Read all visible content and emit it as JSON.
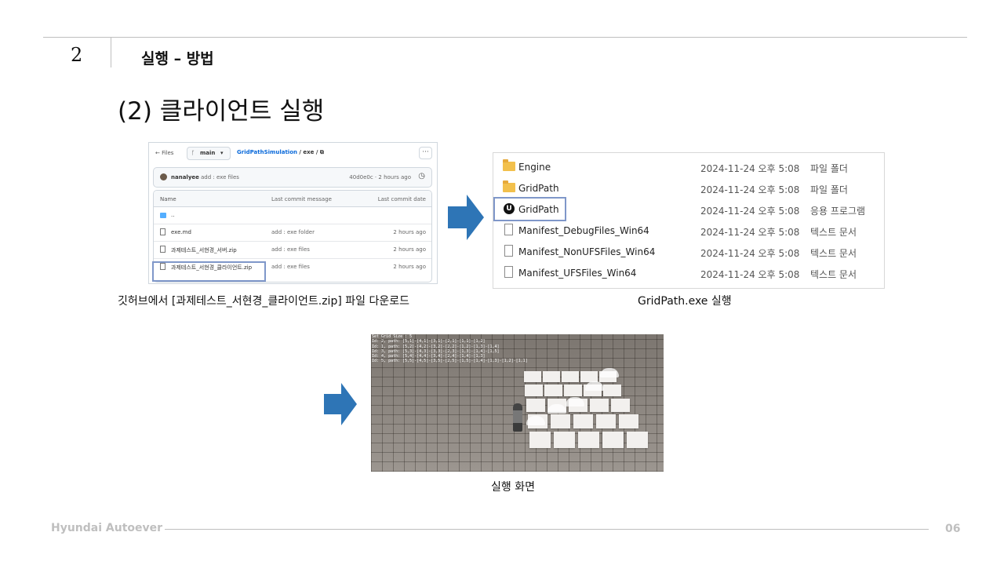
{
  "header": {
    "section_number": "2",
    "section_title": "실행 – 방법"
  },
  "subtitle": "(2) 클라이언트 실행",
  "github": {
    "files_label": "← Files",
    "branch": "main",
    "repo": "GridPathSimulation",
    "path": " / exe / ",
    "more": "···",
    "commit": {
      "user": "nanalyee",
      "message": "add : exe files",
      "hash_time": "40d0e0c · 2 hours ago"
    },
    "columns": [
      "Name",
      "Last commit message",
      "Last commit date"
    ],
    "rows": [
      {
        "name": "..",
        "message": "",
        "date": ""
      },
      {
        "name": "exe.md",
        "message": "add : exe folder",
        "date": "2 hours ago"
      },
      {
        "name": "과제테스트_서현경_서버.zip",
        "message": "add : exe files",
        "date": "2 hours ago"
      },
      {
        "name": "과제테스트_서현경_클라이언트.zip",
        "message": "add : exe files",
        "date": "2 hours ago"
      }
    ],
    "caption": "깃허브에서 [과제테스트_서현경_클라이언트.zip] 파일 다운로드"
  },
  "explorer": {
    "rows": [
      {
        "icon": "folder-icon",
        "name": "Engine",
        "date": "2024-11-24 오후 5:08",
        "type": "파일 폴더"
      },
      {
        "icon": "folder-icon",
        "name": "GridPath",
        "date": "2024-11-24 오후 5:08",
        "type": "파일 폴더"
      },
      {
        "icon": "unreal-icon",
        "name": "GridPath",
        "date": "2024-11-24 오후 5:08",
        "type": "응용 프로그램"
      },
      {
        "icon": "document-icon",
        "name": "Manifest_DebugFiles_Win64",
        "date": "2024-11-24 오후 5:08",
        "type": "텍스트 문서"
      },
      {
        "icon": "document-icon",
        "name": "Manifest_NonUFSFiles_Win64",
        "date": "2024-11-24 오후 5:08",
        "type": "텍스트 문서"
      },
      {
        "icon": "document-icon",
        "name": "Manifest_UFSFiles_Win64",
        "date": "2024-11-24 오후 5:08",
        "type": "텍스트 문서"
      }
    ],
    "caption": "GridPath.exe 실행"
  },
  "game": {
    "log": [
      "Set Grid Size : 5",
      "Id: 2, path: [5,1]-[4,1]-[3,1]-[2,1]-[1,1]-[1,2]",
      "Id: 1, path: [5,2]-[4,2]-[3,2]-[2,2]-[1,2]-[1,3]-[1,4]",
      "Id: 3, path: [5,3]-[4,3]-[3,3]-[2,3]-[1,3]-[1,4]-[1,5]",
      "Id: 4, path: [5,4]-[4,4]-[3,4]-[2,4]-[1,4]-[1,3]",
      "Id: 5, path: [5,5]-[4,5]-[3,5]-[2,5]-[1,5]-[1,4]-[1,3]-[1,2]-[1,1]"
    ],
    "caption": "실행 화면"
  },
  "footer": {
    "company": "Hyundai Autoever",
    "page": "06"
  },
  "colors": {
    "arrow": "#2e75b6",
    "highlight": "#7f97c9"
  }
}
